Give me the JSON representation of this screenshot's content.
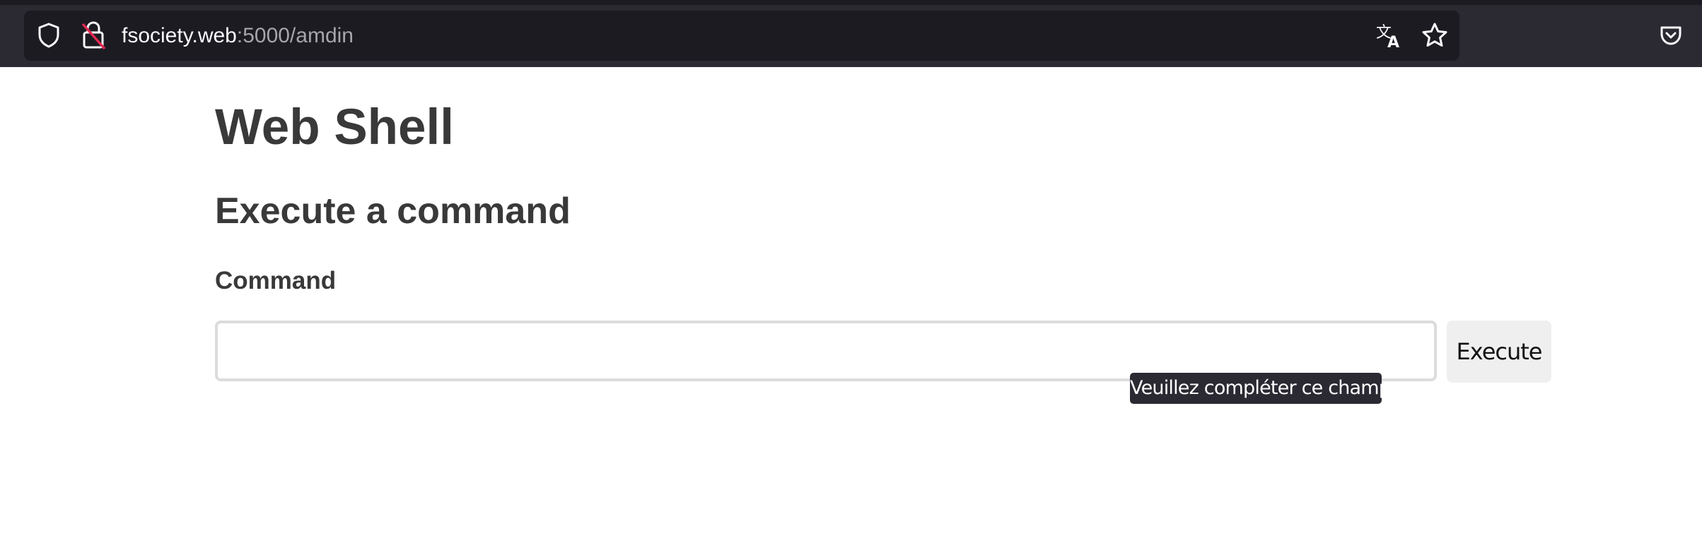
{
  "browser": {
    "url_host": "fsociety.web",
    "url_rest": ":5000/amdin",
    "icons": {
      "shield": "tracking-protection-shield-icon",
      "lock": "insecure-connection-lock-icon",
      "translate": "translate-icon",
      "bookmark": "bookmark-star-icon",
      "pocket": "pocket-icon"
    }
  },
  "page": {
    "title": "Web Shell",
    "subtitle": "Execute a command",
    "command_label": "Command",
    "command_value": "",
    "execute_label": "Execute",
    "validation_tooltip": "Veuillez compléter ce champ."
  }
}
